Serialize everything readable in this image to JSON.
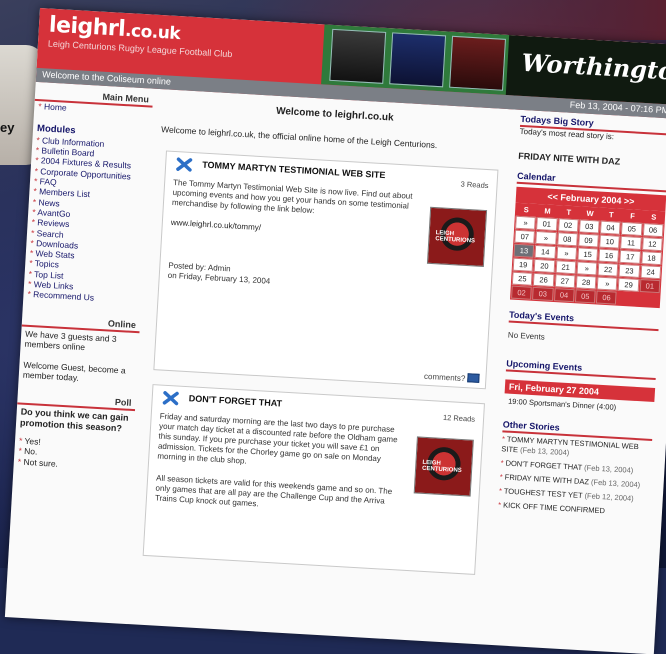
{
  "backdrop": {
    "corner_text": "ey"
  },
  "site": {
    "title": "leighrl",
    "tld": ".co.uk",
    "subtitle": "Leigh Centurions Rugby League Football Club",
    "sponsor": "Worthingtons",
    "welcome_bar": "Welcome to the Coliseum online",
    "date": "Feb 13, 2004 - 07:16 PM"
  },
  "left": {
    "main_menu_title": "Main Menu",
    "home_link": "Home",
    "modules_title": "Modules",
    "modules": [
      "Club Information",
      "Bulletin Board",
      "2004 Fixtures & Results",
      "Corporate Opportunities",
      "FAQ",
      "Members List",
      "News",
      "AvantGo",
      "Reviews",
      "Search",
      "Downloads",
      "Web Stats",
      "Topics",
      "Top List",
      "Web Links",
      "Recommend Us"
    ],
    "online_title": "Online",
    "online_text": "We have 3 guests and 3 members online",
    "guest_text": "Welcome Guest, become a member today.",
    "poll_title": "Poll",
    "poll_question": "Do you think we can gain promotion this season?",
    "poll_options": [
      "Yes!",
      "No.",
      "Not sure."
    ]
  },
  "center": {
    "heading": "Welcome to leighrl.co.uk",
    "intro": "Welcome to leighrl.co.uk, the official online home of the Leigh Centurions.",
    "stories": [
      {
        "title": "TOMMY MARTYN TESTIMONIAL WEB SITE",
        "reads": "3 Reads",
        "body": "The Tommy Martyn Testimonial Web Site is now live. Find out about upcoming events and how you get your hands on some testimonial merchandise by following the link below:",
        "url": "www.leighrl.co.uk/tommy/",
        "posted_by": "Posted by: Admin",
        "posted_on": "on Friday, February 13, 2004",
        "comments": "comments?"
      },
      {
        "title": "DON'T FORGET THAT",
        "reads": "12 Reads",
        "body": "Friday and saturday morning are the last two days to pre purchase your match day ticket at a discounted rate before the Oldham game this sunday. If you pre purchase your ticket you will save £1 on admission. Tickets for the Chorley game go on sale on Monday morning in the club shop.",
        "body2": "All season tickets are valid for this weekends game and so on. The only games that are all pay are the Challenge Cup and the Arriva Trains Cup knock out games."
      }
    ],
    "thumb_label": "LEIGH CENTURIONS"
  },
  "right": {
    "big_story_title": "Todays Big Story",
    "big_story_sub": "Today's most read story is:",
    "big_story": "FRIDAY NITE WITH DAZ",
    "calendar_title": "Calendar",
    "calendar_month": "<< February 2004 >>",
    "calendar_dow": [
      "S",
      "M",
      "T",
      "W",
      "T",
      "F",
      "S"
    ],
    "calendar_days": [
      "»",
      "01",
      "02",
      "03",
      "04",
      "05",
      "06",
      "07",
      "»",
      "08",
      "09",
      "10",
      "11",
      "12",
      "13",
      "14",
      "»",
      "15",
      "16",
      "17",
      "18",
      "19",
      "20",
      "21",
      "»",
      "22",
      "23",
      "24",
      "25",
      "26",
      "27",
      "28",
      "»",
      "29",
      "01",
      "02",
      "03",
      "04",
      "05",
      "06"
    ],
    "today_events_title": "Today's Events",
    "today_events": "No Events",
    "upcoming_title": "Upcoming Events",
    "upcoming_date": "Fri, February 27 2004",
    "upcoming_event": "19:00 Sportsman's Dinner (4:00)",
    "other_title": "Other Stories",
    "other": [
      {
        "title": "TOMMY MARTYN TESTIMONIAL WEB SITE",
        "date": "(Feb 13, 2004)"
      },
      {
        "title": "DON'T FORGET THAT",
        "date": "(Feb 13, 2004)"
      },
      {
        "title": "FRIDAY NITE WITH DAZ",
        "date": "(Feb 13, 2004)"
      },
      {
        "title": "TOUGHEST TEST YET",
        "date": "(Feb 12, 2004)"
      },
      {
        "title": "KICK OFF TIME CONFIRMED",
        "date": ""
      }
    ]
  },
  "colors": {
    "accent": "#d6323a",
    "bar": "#7b7f86",
    "link": "#16166a"
  }
}
